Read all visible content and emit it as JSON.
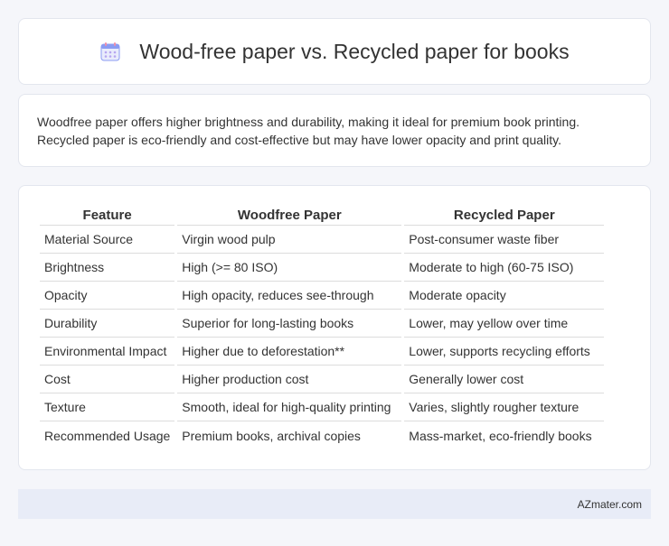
{
  "header": {
    "title": "Wood-free paper vs. Recycled paper for books",
    "icon": "calendar-icon"
  },
  "description": {
    "text": "Woodfree paper offers higher brightness and durability, making it ideal for premium book printing. Recycled paper is eco-friendly and cost-effective but may have lower opacity and print quality."
  },
  "table": {
    "headers": [
      "Feature",
      "Woodfree Paper",
      "Recycled Paper"
    ],
    "rows": [
      [
        "Material Source",
        "Virgin wood pulp",
        "Post-consumer waste fiber"
      ],
      [
        "Brightness",
        "High (>= 80 ISO)",
        "Moderate to high (60-75 ISO)"
      ],
      [
        "Opacity",
        "High opacity, reduces see-through",
        "Moderate opacity"
      ],
      [
        "Durability",
        "Superior for long-lasting books",
        "Lower, may yellow over time"
      ],
      [
        "Environmental Impact",
        "Higher due to deforestation**",
        "Lower, supports recycling efforts"
      ],
      [
        "Cost",
        "Higher production cost",
        "Generally lower cost"
      ],
      [
        "Texture",
        "Smooth, ideal for high-quality printing",
        "Varies, slightly rougher texture"
      ],
      [
        "Recommended Usage",
        "Premium books, archival copies",
        "Mass-market, eco-friendly books"
      ]
    ]
  },
  "footer": {
    "brand": "AZmater.com"
  },
  "colors": {
    "background": "#f5f6fa",
    "card": "#ffffff",
    "footer_bg": "#e8ecf7",
    "icon_accent": "#7b8cf0"
  }
}
